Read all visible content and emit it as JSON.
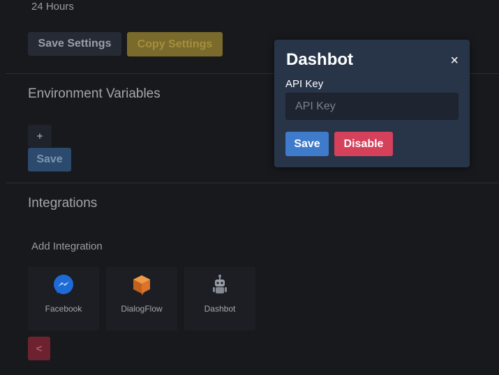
{
  "settings": {
    "retention_value": "24 Hours",
    "save_settings_label": "Save Settings",
    "copy_settings_label": "Copy Settings"
  },
  "environment": {
    "title": "Environment Variables",
    "add_label": "+",
    "save_label": "Save"
  },
  "integrations": {
    "title": "Integrations",
    "add_label": "Add Integration",
    "tiles": [
      {
        "label": "Facebook",
        "icon": "messenger-icon",
        "color": "#1e6bd6"
      },
      {
        "label": "DialogFlow",
        "icon": "dialogflow-icon",
        "color": "#d9742a"
      },
      {
        "label": "Dashbot",
        "icon": "robot-icon",
        "color": "#9aa0a8"
      }
    ],
    "back_label": "<"
  },
  "modal": {
    "title": "Dashbot",
    "close_label": "×",
    "field_label": "API Key",
    "field_placeholder": "API Key",
    "field_value": "",
    "save_label": "Save",
    "disable_label": "Disable"
  },
  "colors": {
    "background": "#18191d",
    "modal_bg": "#283549",
    "primary": "#3e7ccb",
    "danger": "#d5405b",
    "warning": "#7a6a2c"
  }
}
